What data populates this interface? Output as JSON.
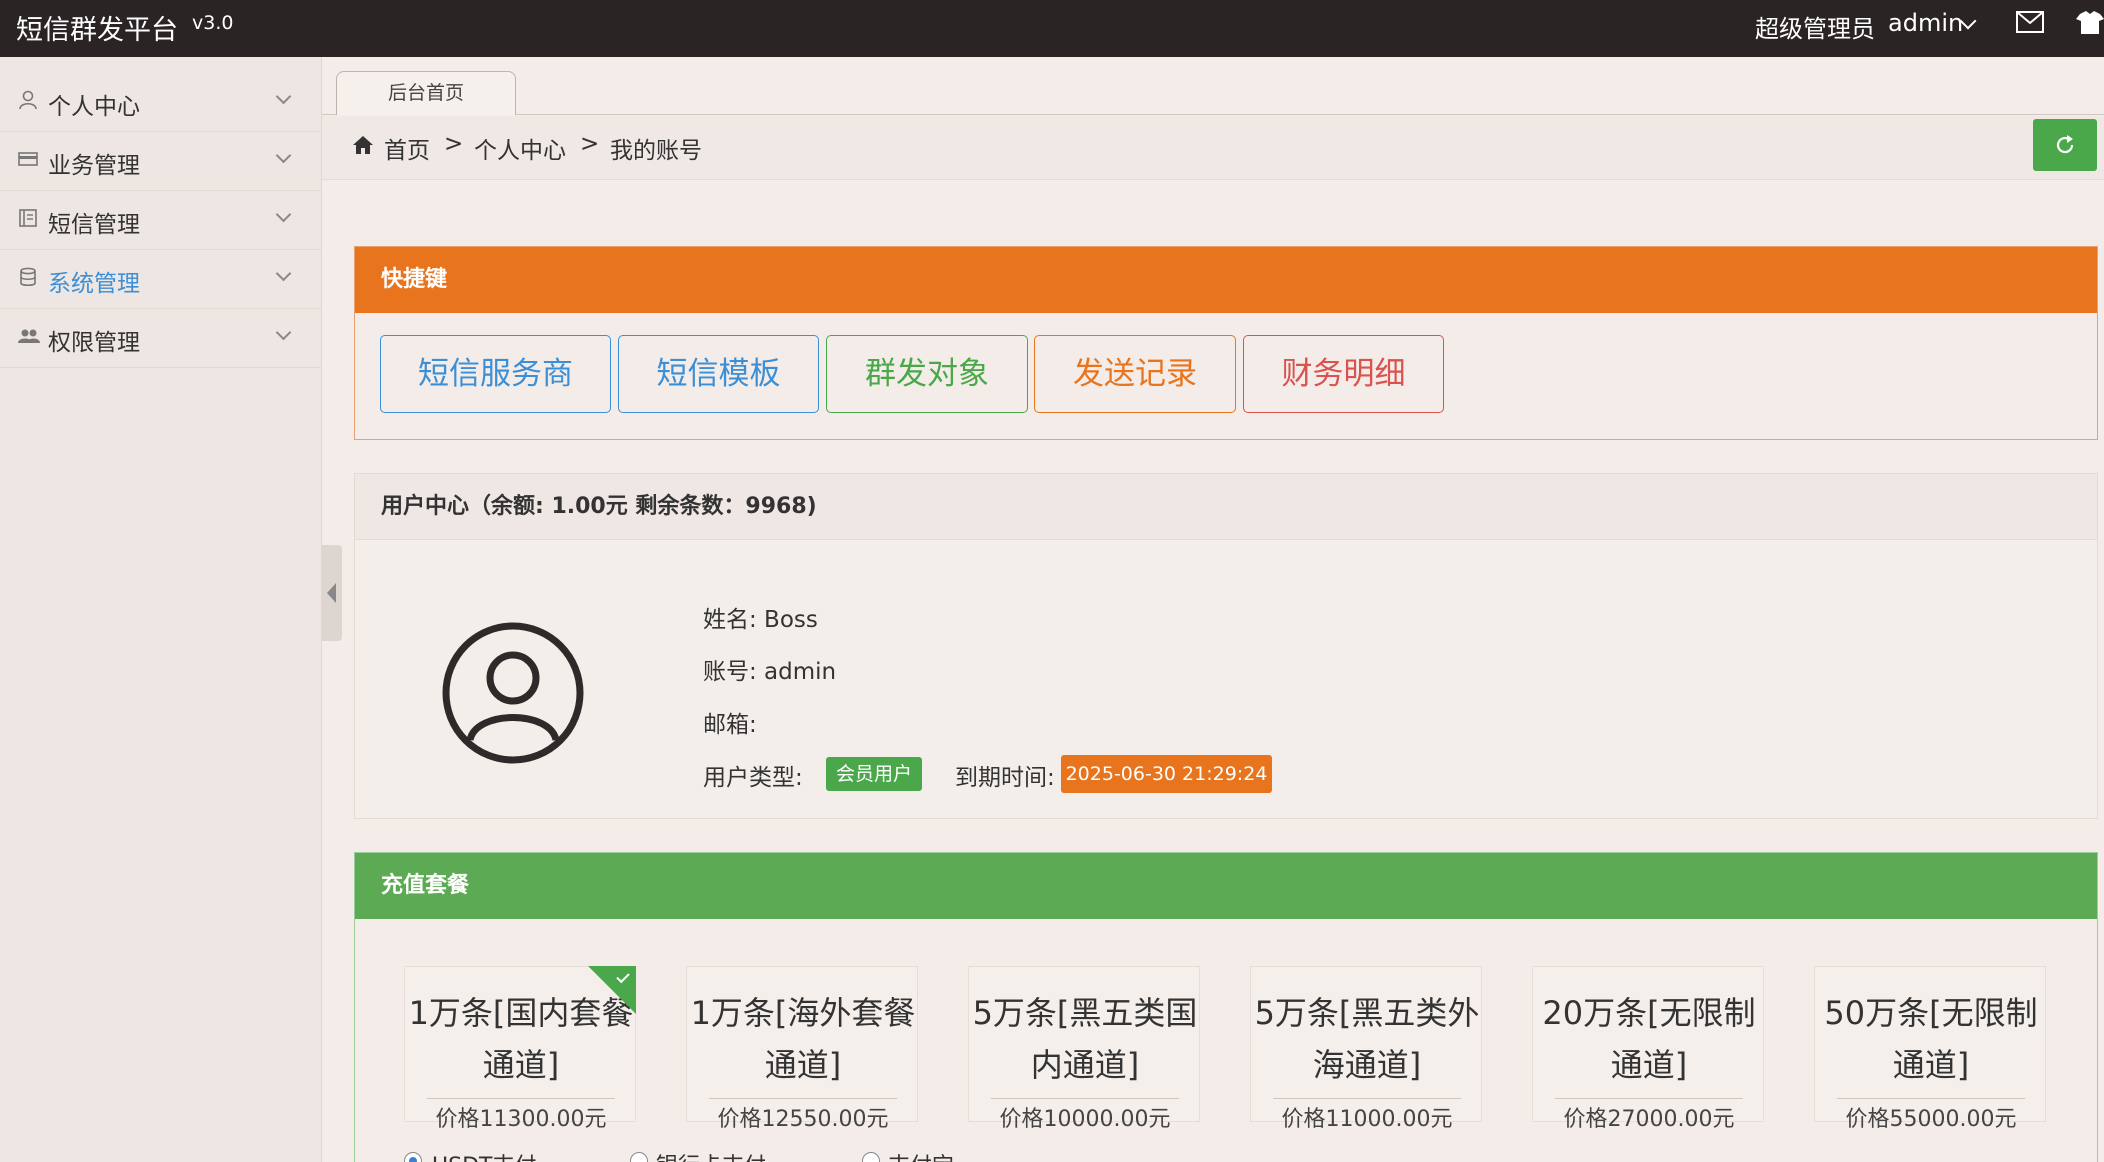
{
  "header": {
    "brand": "短信群发平台",
    "version": "v3.0",
    "role": "超级管理员",
    "username": "admin"
  },
  "sidebar": {
    "items": [
      {
        "label": "个人中心",
        "icon": "user-icon"
      },
      {
        "label": "业务管理",
        "icon": "card-icon"
      },
      {
        "label": "短信管理",
        "icon": "book-icon"
      },
      {
        "label": "系统管理",
        "icon": "database-icon",
        "active": true
      },
      {
        "label": "权限管理",
        "icon": "users-icon"
      }
    ]
  },
  "tabs": {
    "home": "后台首页"
  },
  "breadcrumb": {
    "home": "首页",
    "sep1": ">",
    "level1": "个人中心",
    "sep2": ">",
    "current": "我的账号"
  },
  "quick": {
    "title": "快捷键",
    "buttons": [
      {
        "label": "短信服务商",
        "color": "#3b8fd6"
      },
      {
        "label": "短信模板",
        "color": "#3b8fd6"
      },
      {
        "label": "群发对象",
        "color": "#4aa84a"
      },
      {
        "label": "发送记录",
        "color": "#e8751e"
      },
      {
        "label": "财务明细",
        "color": "#d9534f"
      }
    ]
  },
  "user_center": {
    "title": "用户中心（余额: 1.00元 剩余条数：9968)",
    "name_label": "姓名: Boss",
    "account_label": "账号: admin",
    "email_label": "邮箱:",
    "type_label": "用户类型:",
    "type_badge": "会员用户",
    "expire_label": "到期时间:",
    "expire_value": "2025-06-30 21:29:24"
  },
  "recharge": {
    "title": "充值套餐",
    "packages": [
      {
        "name_line1": "1万条[国内套餐",
        "name_line2": "通道]",
        "price": "价格11300.00元",
        "selected": true
      },
      {
        "name_line1": "1万条[海外套餐",
        "name_line2": "通道]",
        "price": "价格12550.00元"
      },
      {
        "name_line1": "5万条[黑五类国",
        "name_line2": "内通道]",
        "price": "价格10000.00元"
      },
      {
        "name_line1": "5万条[黑五类外",
        "name_line2": "海通道]",
        "price": "价格11000.00元"
      },
      {
        "name_line1": "20万条[无限制",
        "name_line2": "通道]",
        "price": "价格27000.00元"
      },
      {
        "name_line1": "50万条[无限制",
        "name_line2": "通道]",
        "price": "价格55000.00元"
      }
    ],
    "pay_options": [
      "USDT支付",
      "银行卡支付",
      "支付宝"
    ]
  },
  "colors": {
    "topbar": "#2a2424",
    "orange": "#e8751e",
    "green": "#5daa55",
    "active_blue": "#3b8fd6"
  }
}
